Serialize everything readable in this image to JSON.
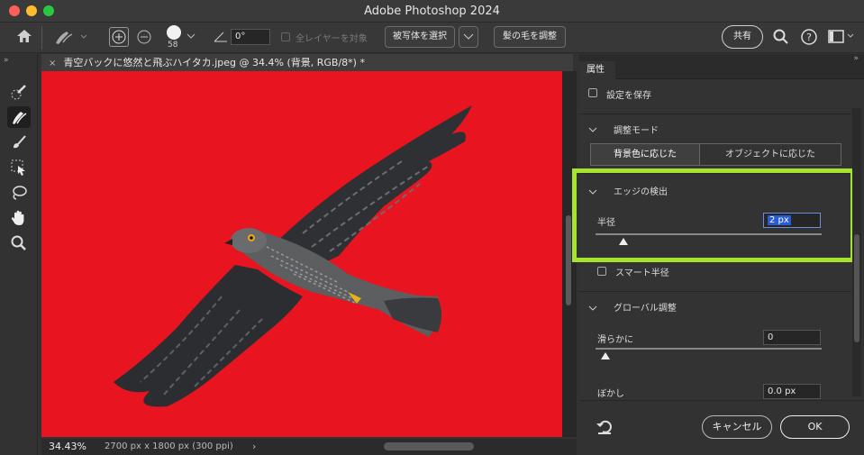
{
  "window": {
    "title": "Adobe Photoshop 2024"
  },
  "options_bar": {
    "brush_size": "58",
    "angle_value": "0°",
    "sample_all_layers": "全レイヤーを対象",
    "select_subject": "被写体を選択",
    "refine_hair": "髪の毛を調整",
    "share": "共有"
  },
  "document": {
    "tab_title": "青空バックに悠然と飛ぶハイタカ.jpeg @ 34.4% (背景, RGB/8*) *",
    "zoom": "34.43%",
    "dimensions": "2700 px x 1800 px (300 ppi)"
  },
  "panel": {
    "tab": "属性",
    "save_settings": "設定を保存",
    "adjust_mode": {
      "title": "調整モード",
      "option_bg": "背景色に応じた",
      "option_obj": "オブジェクトに応じた",
      "selected": "背景色に応じた"
    },
    "edge_detection": {
      "title": "エッジの検出",
      "radius_label": "半径",
      "radius_value": "2 px",
      "radius_level": 0.2,
      "smart_radius": "スマート半径"
    },
    "global": {
      "title": "グローバル調整",
      "smooth_label": "滑らかに",
      "smooth_value": "0",
      "feather_label": "ぼかし",
      "feather_value": "0.0 px"
    },
    "cancel": "キャンセル",
    "ok": "OK"
  },
  "colors": {
    "canvas_bg": "#e81520",
    "highlight": "#a7e22e",
    "field_selected": "#2a5bd7"
  }
}
